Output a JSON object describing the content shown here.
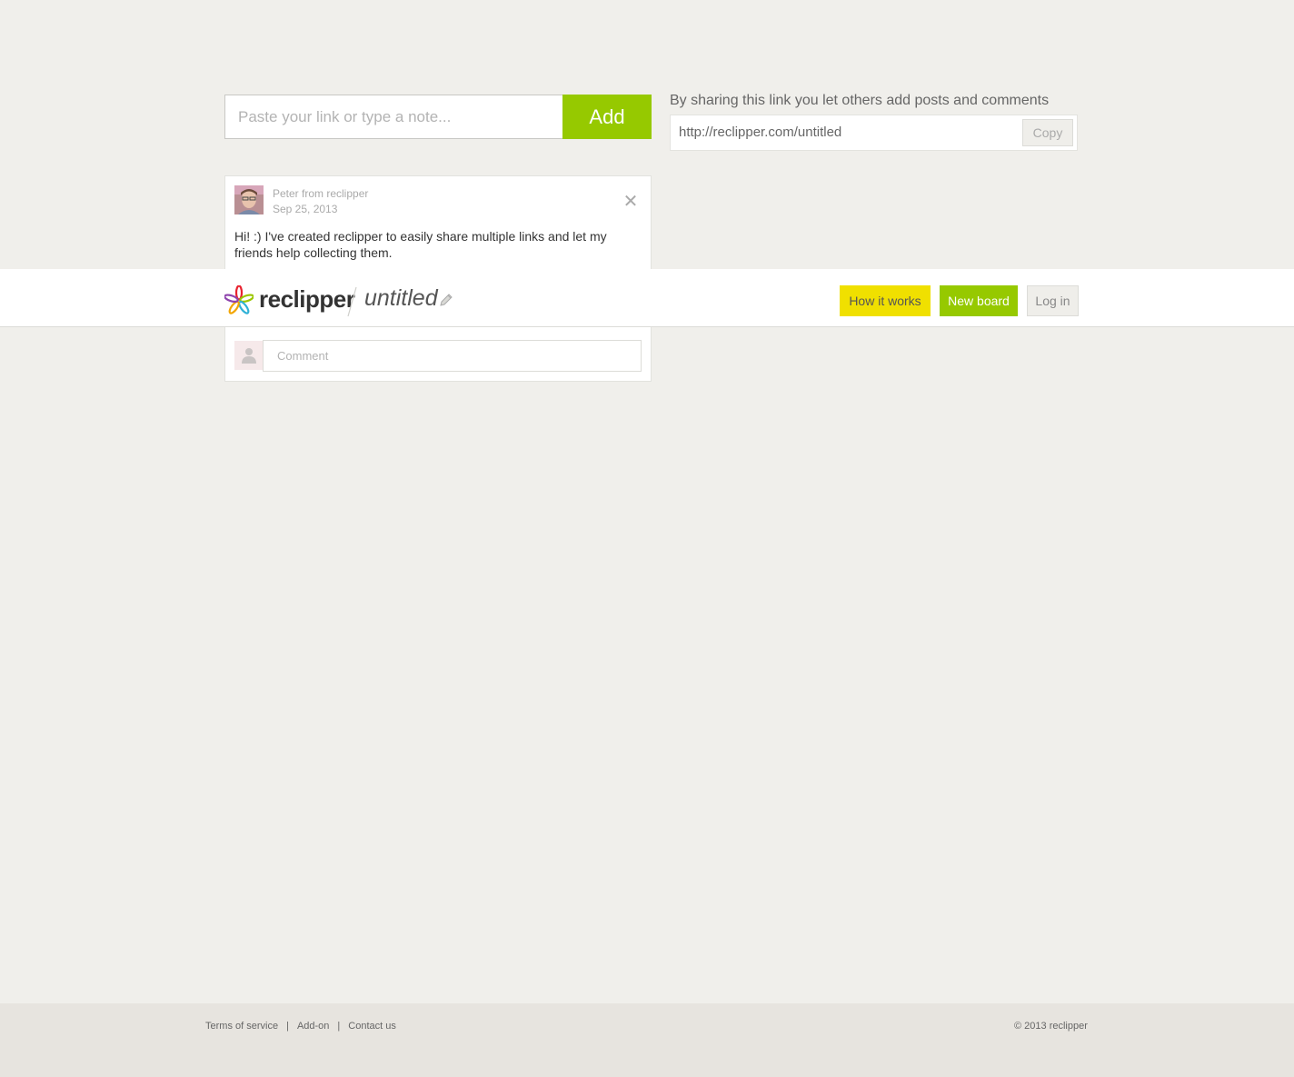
{
  "composer": {
    "placeholder": "Paste your link or type a note...",
    "add_label": "Add"
  },
  "share": {
    "text": "By sharing this link you let others add posts and comments",
    "url": "http://reclipper.com/untitled",
    "copy_label": "Copy"
  },
  "post": {
    "author": "Peter from reclipper",
    "date": "Sep 25, 2013",
    "body": "Hi! :) I've created reclipper to easily share multiple links and let my friends help collecting them.",
    "close_icon": "close-icon",
    "comment_placeholder": "Comment"
  },
  "header": {
    "logo_text": "reclipper",
    "board_title": "untitled",
    "edit_icon": "pencil-icon",
    "nav": {
      "how": "How it works",
      "new_board": "New board",
      "login": "Log in"
    }
  },
  "footer": {
    "links": [
      "Terms of service",
      "Add-on",
      "Contact us"
    ],
    "separator": "|",
    "copyright": "© 2013 reclipper"
  },
  "colors": {
    "accent_green": "#96c900",
    "accent_yellow": "#f0e000",
    "background": "#f0efeb"
  }
}
